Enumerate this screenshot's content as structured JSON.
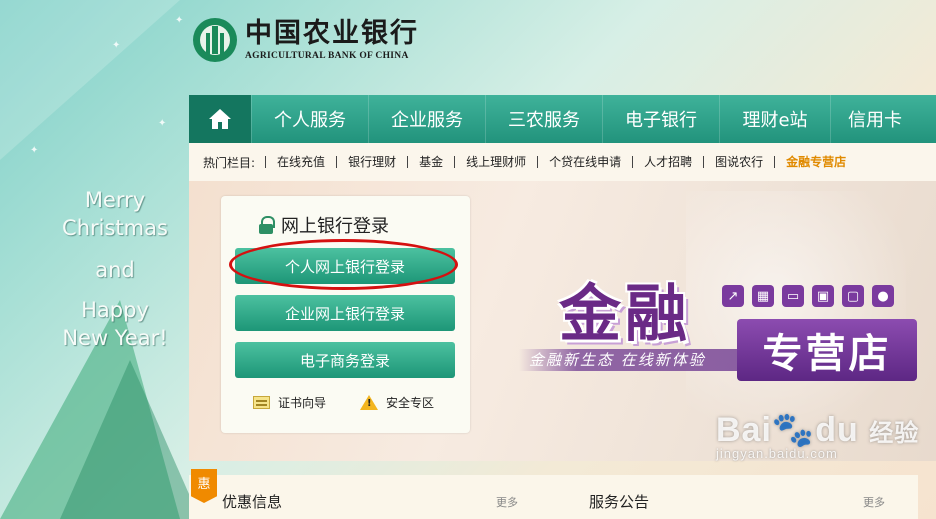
{
  "logo": {
    "cn": "中国农业银行",
    "en": "AGRICULTURAL BANK OF CHINA"
  },
  "greeting": {
    "line1": "Merry",
    "line2": "Christmas",
    "line3": "and",
    "line4": "Happy",
    "line5": "New Year!"
  },
  "nav": {
    "home_icon": "home-icon",
    "items": [
      "个人服务",
      "企业服务",
      "三农服务",
      "电子银行",
      "理财e站",
      "信用卡"
    ]
  },
  "hotbar": {
    "label": "热门栏目:",
    "links": [
      "在线充值",
      "银行理财",
      "基金",
      "线上理财师",
      "个贷在线申请",
      "人才招聘",
      "图说农行"
    ],
    "highlight": "金融专营店"
  },
  "login": {
    "title": "网上银行登录",
    "buttons": [
      "个人网上银行登录",
      "企业网上银行登录",
      "电子商务登录"
    ],
    "links": [
      "证书向导",
      "安全专区"
    ]
  },
  "banner": {
    "big": "金融",
    "sub": "专营店",
    "slogan": "金融新生态  在线新体验",
    "icons": [
      "chart-icon",
      "cart-icon",
      "card-icon",
      "pos-icon",
      "chat-icon",
      "user-icon"
    ]
  },
  "bottom": {
    "badge": "惠",
    "section1": "优惠信息",
    "section2": "服务公告",
    "more": "更多"
  },
  "watermark": {
    "main": "Bai",
    "paw": "du",
    "cn": "经验",
    "url": "jingyan.baidu.com"
  },
  "colors": {
    "nav_green": "#22937c",
    "button_green": "#1d9677",
    "highlight_orange": "#e08a00",
    "banner_purple": "#6a2a86",
    "oval_red": "#d51010"
  }
}
